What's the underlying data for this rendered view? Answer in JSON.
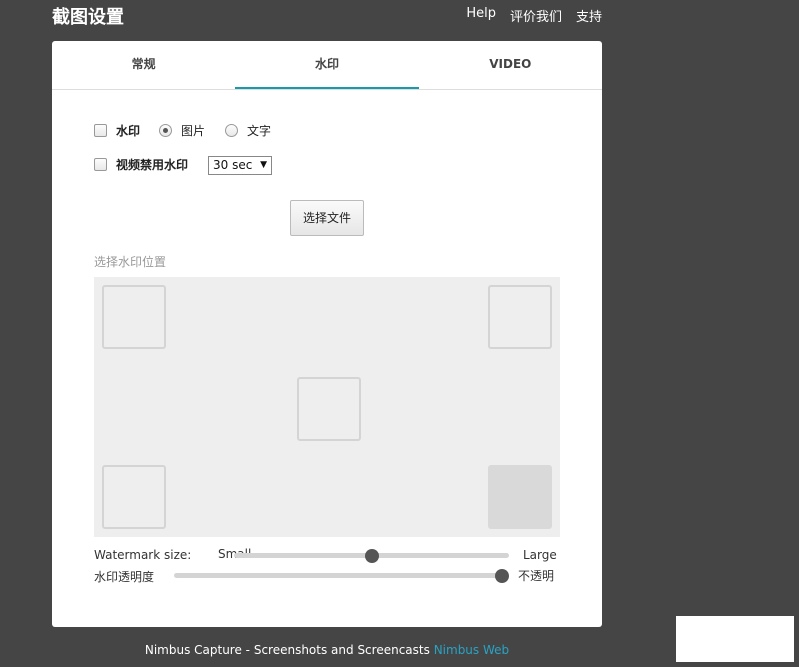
{
  "header": {
    "title": "截图设置",
    "links": [
      "Help",
      "评价我们",
      "支持"
    ]
  },
  "tabs": [
    {
      "label": "常规",
      "active": false
    },
    {
      "label": "水印",
      "active": true
    },
    {
      "label": "VIDEO",
      "active": false
    }
  ],
  "watermark": {
    "enable_label": "水印",
    "enable_checked": false,
    "type_options": [
      {
        "label": "图片",
        "checked": true
      },
      {
        "label": "文字",
        "checked": false
      }
    ],
    "disable_video_label": "视频禁用水印",
    "disable_video_checked": false,
    "duration_value": "30 sec",
    "file_button": "选择文件",
    "position_label": "选择水印位置",
    "selected_position": "bottom-right",
    "size_label": "Watermark size:",
    "size_min_label": "Small",
    "size_max_label": "Large",
    "size_value": 0.5,
    "opacity_label": "水印透明度",
    "opacity_max_label": "不透明",
    "opacity_value": 1.0
  },
  "footer": {
    "text": "Nimbus Capture - Screenshots and Screencasts",
    "link": "Nimbus Web"
  },
  "colors": {
    "background": "#454545",
    "accent": "#1a9aa8",
    "link": "#29a3c4"
  }
}
